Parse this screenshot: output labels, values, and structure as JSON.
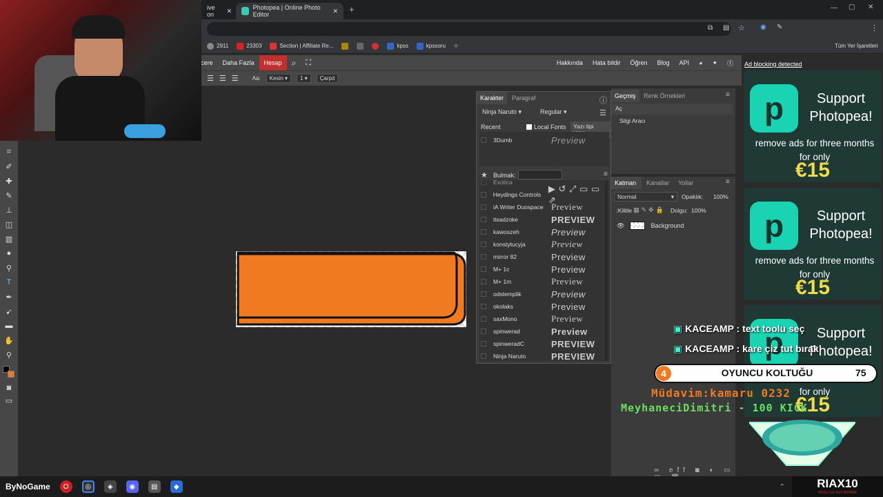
{
  "browser": {
    "tabs": [
      {
        "label": "ive on"
      },
      {
        "label": "Photopea | Online Photo Editor"
      }
    ],
    "bookmarks": [
      "2911",
      "23303",
      "Section | Affiliate Re...",
      "kpss",
      "kpssoru"
    ],
    "all_bookmarks": "Tüm Yer İşaretleri"
  },
  "menu": {
    "items": [
      "cere",
      "Daha Fazla",
      "Hesap"
    ],
    "right_items": [
      "Hakkında",
      "Hata bildir",
      "Öğren",
      "Blog",
      "API"
    ]
  },
  "options": {
    "aa_label": "Aa:",
    "aa_value": "Kesin",
    "size_value": "1",
    "warp_label": "Çarpıt"
  },
  "character_panel": {
    "tabs": [
      "Karakter",
      "Paragraf"
    ],
    "font_family": "Ninja Naruto",
    "font_style": "Regular",
    "recent_label": "Recent",
    "local_fonts_label": "Local Fonts",
    "upload_font_label": "Yazı tipi Yükle",
    "recent_font": {
      "name": "3Dumb",
      "preview": "Preview"
    },
    "search_label": "Bulmak:",
    "search_value": "",
    "partial_font": "Exotica",
    "fonts": [
      {
        "name": "Heydings Controls",
        "preview": "▶ ↺ ⤢ ▭ ▭ ⇗"
      },
      {
        "name": "iA Writer Duospace",
        "preview": "Preview"
      },
      {
        "name": "itsadzoke",
        "preview": "PREVIEW"
      },
      {
        "name": "kawoszeh",
        "preview": "Preview"
      },
      {
        "name": "konstytucyja",
        "preview": "Preview"
      },
      {
        "name": "mirror 82",
        "preview": "Preview"
      },
      {
        "name": "M+ 1c",
        "preview": "Preview"
      },
      {
        "name": "M+ 1m",
        "preview": "Preview"
      },
      {
        "name": "odstemplik",
        "preview": "Preview"
      },
      {
        "name": "okolaks",
        "preview": "Preview"
      },
      {
        "name": "saxMono",
        "preview": "Preview"
      },
      {
        "name": "spinwerad",
        "preview": "Preview"
      },
      {
        "name": "spinweradC",
        "preview": "PREVIEW"
      },
      {
        "name": "Ninja Naruto",
        "preview": "PREVIEW"
      }
    ]
  },
  "history_panel": {
    "tabs": [
      "Geçmiş",
      "Renk Örnekleri"
    ],
    "items": [
      "Aç",
      "Silgi Aracı"
    ]
  },
  "layers_panel": {
    "tabs": [
      "Katman",
      "Kanallar",
      "Yollar"
    ],
    "blend_mode": "Normal",
    "opacity_label": "Opaklık:",
    "opacity_value": "100%",
    "lock_label": "Kilitle:",
    "fill_label": "Dolgu:",
    "fill_value": "100%",
    "layer_name": "Background"
  },
  "ads": {
    "notice": "Ad blocking detected",
    "title": "Support Photopea!",
    "subtitle": "remove ads for three months for only",
    "price": "€15"
  },
  "stream_overlay": {
    "chat": [
      {
        "user": "KACEAMP",
        "message": "text toolu seç"
      },
      {
        "user": "KACEAMP",
        "message": "kare çiz tut bırak"
      }
    ],
    "goal_badge": "4",
    "goal_label": "OYUNCU KOLTUĞU",
    "goal_count": "75",
    "ticker_1": "Müdavim:kamaru 0232",
    "ticker_2": "MeyhaneciDimitri - 100 KICK",
    "brand": "RIAX10",
    "brand_sub": "KODU İLE %10 İNDİRİM",
    "taskbar_label": "ByNoGame"
  },
  "colors": {
    "accent_red": "#c12f2f",
    "photopea_teal": "#19d3b2",
    "price_yellow": "#f0d94a",
    "shape_orange": "#f07a22"
  }
}
